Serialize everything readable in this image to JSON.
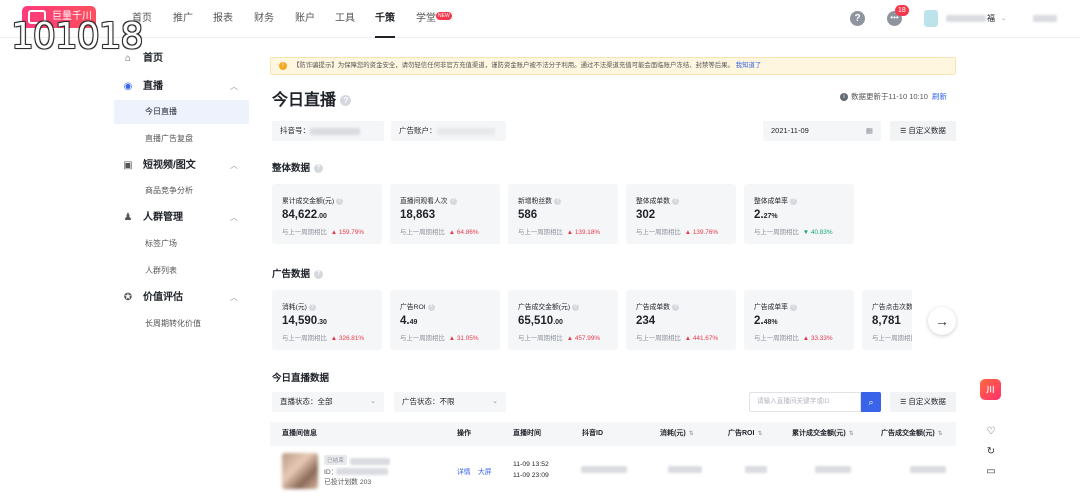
{
  "header": {
    "logo_text": "巨量千川",
    "watermark": "101018",
    "nav": [
      "首页",
      "推广",
      "报表",
      "财务",
      "账户",
      "工具",
      "千策",
      "学堂"
    ],
    "active_nav": "千策",
    "new_badge": "NEW",
    "notification_count": "18",
    "user_suffix": "福"
  },
  "sidebar": {
    "groups": [
      {
        "label": "首页",
        "icon": "home-icon",
        "children": []
      },
      {
        "label": "直播",
        "icon": "live-icon",
        "children": [
          "今日直播",
          "直播广告复盘"
        ]
      },
      {
        "label": "短视频/图文",
        "icon": "video-icon",
        "children": [
          "商品竞争分析"
        ]
      },
      {
        "label": "人群管理",
        "icon": "people-icon",
        "children": [
          "标签广场",
          "人群列表"
        ]
      },
      {
        "label": "价值评估",
        "icon": "value-icon",
        "children": [
          "长周期转化价值"
        ]
      }
    ],
    "active_item": "今日直播"
  },
  "notice": {
    "text": "【防诈骗提示】为保障您的资金安全，请勿轻信任何非官方充值渠道，谨防资金账户被不法分子利用。通过不法渠道充值可能会面临账户冻结、封禁等后果。",
    "link": "我知道了"
  },
  "page": {
    "title": "今日直播",
    "update_time": "数据更新于11-10 10:10",
    "refresh": "刷新"
  },
  "filters": {
    "douyin_label": "抖音号：",
    "account_label": "广告账户：",
    "date": "2021-11-09",
    "custom_btn": "自定义数据"
  },
  "overall": {
    "title": "整体数据",
    "compare_label": "与上一周期相比",
    "cards": [
      {
        "label": "累计成交金额(元)",
        "int": "84,622",
        "dec": ".00",
        "change": "159.79%",
        "dir": "up"
      },
      {
        "label": "直播间观看人次",
        "int": "18,863",
        "dec": "",
        "change": "64.86%",
        "dir": "up"
      },
      {
        "label": "新增粉丝数",
        "int": "586",
        "dec": "",
        "change": "139.18%",
        "dir": "up"
      },
      {
        "label": "整体成单数",
        "int": "302",
        "dec": "",
        "change": "139.76%",
        "dir": "up"
      },
      {
        "label": "整体成单率",
        "int": "2.",
        "dec": "27%",
        "change": "40.83%",
        "dir": "down"
      }
    ]
  },
  "ads": {
    "title": "广告数据",
    "cards": [
      {
        "label": "消耗(元)",
        "int": "14,590",
        "dec": ".30",
        "change": "326.81%",
        "dir": "up"
      },
      {
        "label": "广告ROI",
        "int": "4.",
        "dec": "49",
        "change": "31.05%",
        "dir": "up"
      },
      {
        "label": "广告成交金额(元)",
        "int": "65,510",
        "dec": ".00",
        "change": "457.99%",
        "dir": "up"
      },
      {
        "label": "广告成单数",
        "int": "234",
        "dec": "",
        "change": "441.67%",
        "dir": "up"
      },
      {
        "label": "广告成单率",
        "int": "2.",
        "dec": "48%",
        "change": "33.33%",
        "dir": "up"
      },
      {
        "label": "广告点击次数",
        "int": "8,781",
        "dec": "",
        "change": "",
        "dir": ""
      }
    ]
  },
  "live_data": {
    "title": "今日直播数据",
    "status_filter": "直播状态：全部",
    "ad_status_filter": "广告状态：不限",
    "search_placeholder": "请输入直播间关键字或ID",
    "custom_btn": "自定义数据",
    "columns": [
      "直播间信息",
      "操作",
      "直播时间",
      "抖音ID",
      "消耗(元)",
      "广告ROI",
      "累计成交金额(元)",
      "广告成交金额(元)"
    ],
    "row": {
      "tag": "已结束",
      "id_prefix": "ID：",
      "fans_text": "已投计划数 203",
      "actions": [
        "详情",
        "大屏"
      ],
      "start": "11-09 13:52",
      "end": "11-09 23:09"
    }
  }
}
